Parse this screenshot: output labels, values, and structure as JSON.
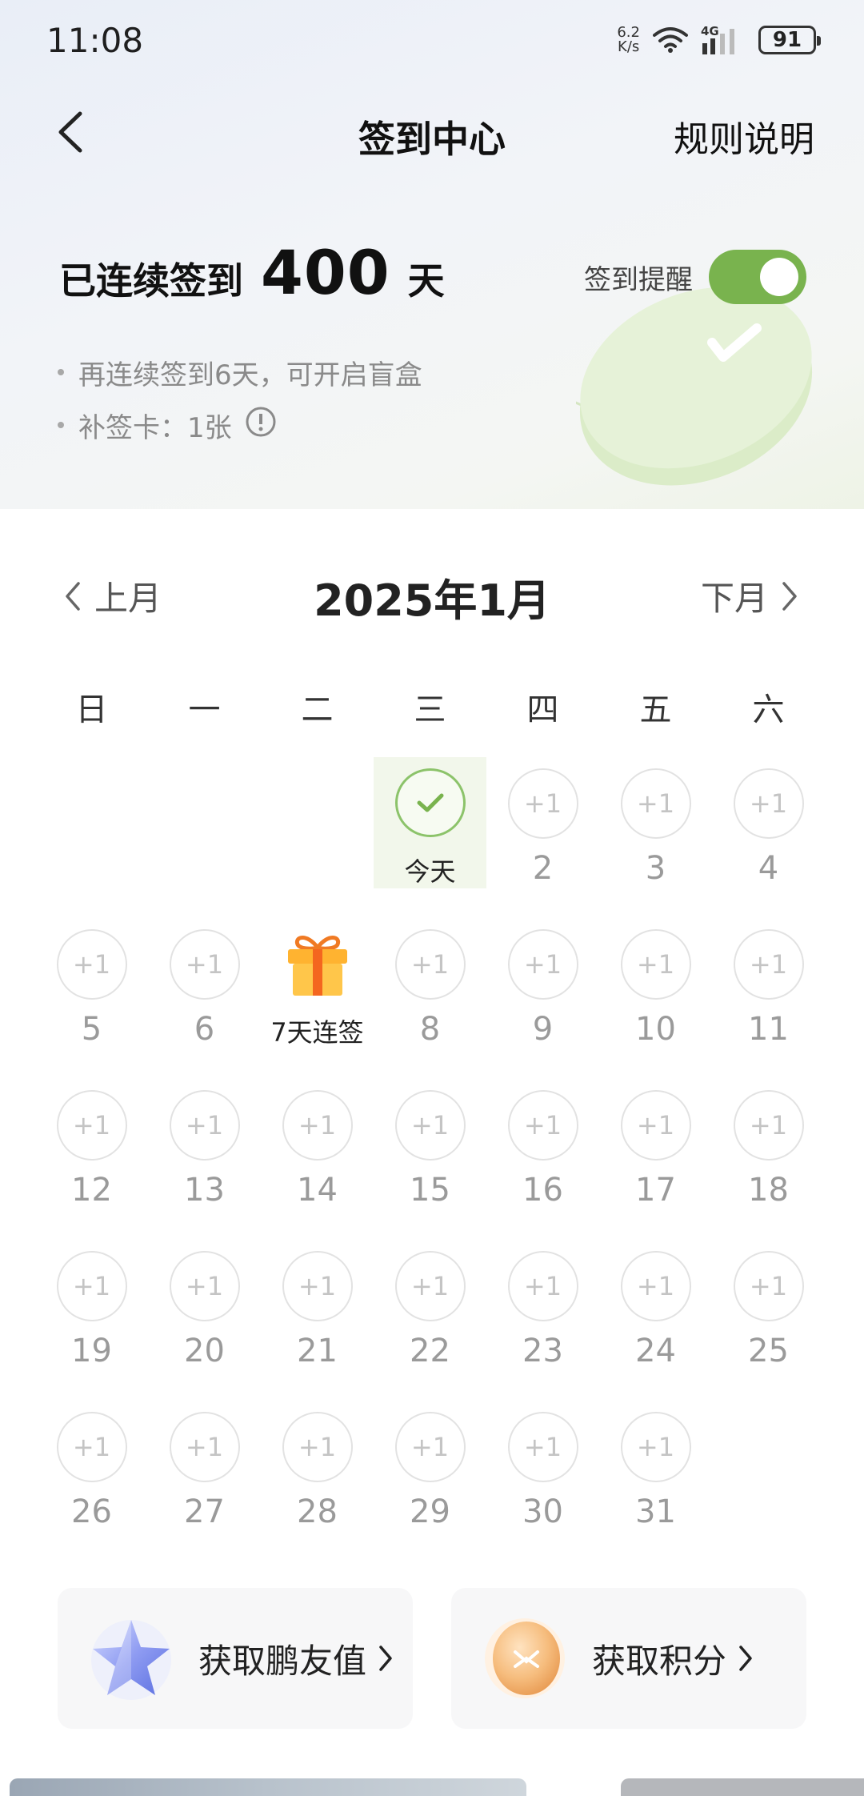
{
  "status_bar": {
    "time": "11:08",
    "net_speed_value": "6.2",
    "net_speed_unit": "K/s",
    "network_type": "4G",
    "battery": "91"
  },
  "header": {
    "title": "签到中心",
    "rules_label": "规则说明"
  },
  "streak": {
    "prefix": "已连续签到",
    "days": "400",
    "unit": "天"
  },
  "reminder": {
    "label": "签到提醒",
    "enabled": true
  },
  "info": {
    "blind_box_note": "再连续签到6天，可开启盲盒",
    "makeup_card": "补签卡：1张"
  },
  "calendar": {
    "prev_label": "上月",
    "next_label": "下月",
    "month_title": "2025年1月",
    "weekdays": [
      "日",
      "一",
      "二",
      "三",
      "四",
      "五",
      "六"
    ],
    "point_label": "+1",
    "today_label": "今天",
    "gift_label": "7天连签"
  },
  "rewards": {
    "friend_value_label": "获取鹏友值",
    "points_label": "获取积分"
  },
  "colors": {
    "accent_green": "#79b34e",
    "today_bg": "#f2f7eb"
  }
}
